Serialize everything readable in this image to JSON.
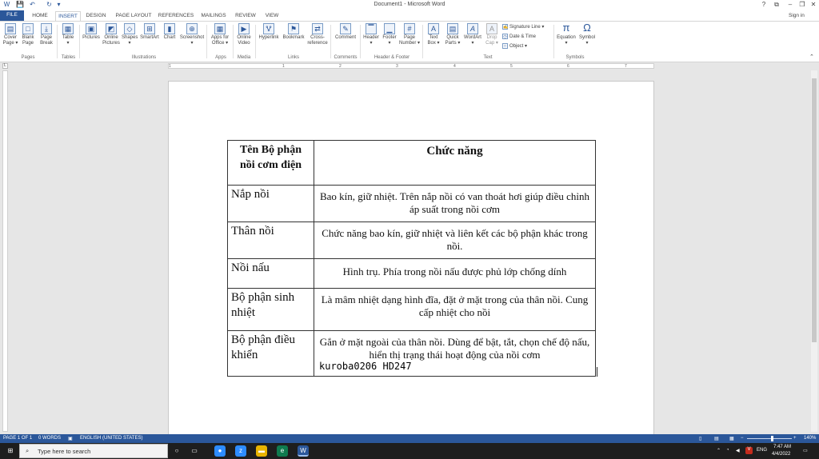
{
  "window": {
    "title": "Document1 - Microsoft Word",
    "signin": "Sign in",
    "controls": [
      "?",
      "⧉",
      "–",
      "❐",
      "✕"
    ]
  },
  "qat": {
    "save": "💾",
    "undo": "↶",
    "redo": "↻",
    "more": "▾"
  },
  "tabs": [
    "FILE",
    "HOME",
    "INSERT",
    "DESIGN",
    "PAGE LAYOUT",
    "REFERENCES",
    "MAILINGS",
    "REVIEW",
    "VIEW"
  ],
  "ribbon": {
    "pages": {
      "cover": "Cover\nPage ▾",
      "blank": "Blank\nPage",
      "break": "Page\nBreak",
      "group": "Pages"
    },
    "tables": {
      "table": "Table\n▾",
      "group": "Tables"
    },
    "illustrations": {
      "pictures": "Pictures",
      "online": "Online\nPictures",
      "shapes": "Shapes\n▾",
      "smartart": "SmartArt",
      "chart": "Chart",
      "screenshot": "Screenshot\n▾",
      "group": "Illustrations"
    },
    "apps": {
      "apps": "Apps for\nOffice ▾",
      "group": "Apps"
    },
    "media": {
      "video": "Online\nVideo",
      "group": "Media"
    },
    "links": {
      "hyperlink": "Hyperlink",
      "bookmark": "Bookmark",
      "cross": "Cross-\nreference",
      "group": "Links"
    },
    "comments": {
      "comment": "Comment",
      "group": "Comments"
    },
    "header_footer": {
      "header": "Header\n▾",
      "footer": "Footer\n▾",
      "pagenum": "Page\nNumber ▾",
      "group": "Header & Footer"
    },
    "text": {
      "textbox": "Text\nBox ▾",
      "quick": "Quick\nParts ▾",
      "wordart": "WordArt\n▾",
      "dropcap": "Drop\nCap ▾",
      "sigline": "Signature Line ▾",
      "datetime": "Date & Time",
      "object": "Object ▾",
      "group": "Text"
    },
    "symbols": {
      "equation": "Equation\n▾",
      "symbol": "Symbol\n▾",
      "group": "Symbols"
    }
  },
  "ruler_numbers": [
    "1",
    "1",
    "2",
    "3",
    "4",
    "5",
    "6",
    "7"
  ],
  "table": {
    "header": {
      "col1": "Tên Bộ phận nồi cơm điện",
      "col2": "Chức năng"
    },
    "rows": [
      {
        "part": "Nắp nồi",
        "function": "Bao kín, giữ nhiệt. Trên nắp nồi có van thoát hơi giúp điều chỉnh áp suất trong nồi cơm"
      },
      {
        "part": "Thân nồi",
        "function": "Chức năng bao kín, giữ nhiệt và liên kết các bộ phận khác trong nồi."
      },
      {
        "part": "Nồi nấu",
        "function": "Hình trụ. Phía trong nồi nấu được phủ lớp chống dính"
      },
      {
        "part": "Bộ phận sinh nhiệt",
        "function": "Là mâm nhiệt dạng hình đĩa, đặt ở mặt trong của thân nồi. Cung cấp nhiệt cho nồi"
      },
      {
        "part": "Bộ phận điều khiển",
        "function": "Gắn ở mặt ngoài của thân nồi. Dùng để bật, tắt, chọn chế độ nấu, hiển thị trạng thái hoạt động của nồi cơm"
      }
    ],
    "watermark": "kuroba0206 HD247"
  },
  "status": {
    "page": "PAGE 1 OF 1",
    "words": "0 WORDS",
    "language": "ENGLISH (UNITED STATES)",
    "zoom": "140%"
  },
  "taskbar": {
    "search_placeholder": "Type here to search",
    "time": "7:47 AM",
    "date": "4/4/2022",
    "lang": "ENG"
  },
  "colors": {
    "accent": "#2b579a",
    "taskbar": "#1e1e1e"
  }
}
